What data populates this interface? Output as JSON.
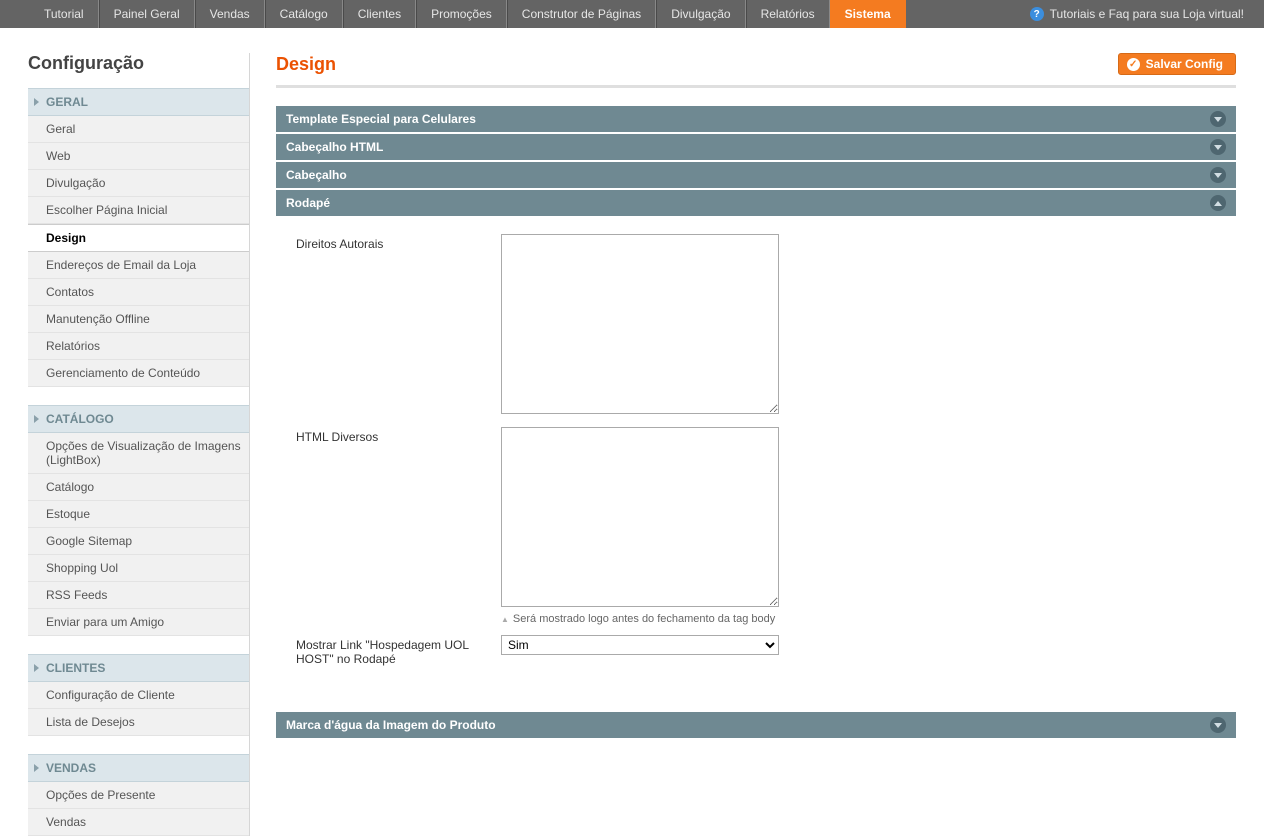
{
  "topnav": {
    "items": [
      {
        "label": "Tutorial"
      },
      {
        "label": "Painel Geral"
      },
      {
        "label": "Vendas"
      },
      {
        "label": "Catálogo"
      },
      {
        "label": "Clientes"
      },
      {
        "label": "Promoções"
      },
      {
        "label": "Construtor de Páginas"
      },
      {
        "label": "Divulgação"
      },
      {
        "label": "Relatórios"
      },
      {
        "label": "Sistema",
        "active": true
      }
    ],
    "help": "Tutoriais e Faq para sua Loja virtual!"
  },
  "sidebar": {
    "title": "Configuração",
    "sections": [
      {
        "header": "GERAL",
        "items": [
          {
            "label": "Geral"
          },
          {
            "label": "Web"
          },
          {
            "label": "Divulgação"
          },
          {
            "label": "Escolher Página Inicial"
          },
          {
            "label": "Design",
            "active": true
          },
          {
            "label": "Endereços de Email da Loja"
          },
          {
            "label": "Contatos"
          },
          {
            "label": "Manutenção Offline"
          },
          {
            "label": "Relatórios"
          },
          {
            "label": "Gerenciamento de Conteúdo"
          }
        ]
      },
      {
        "header": "CATÁLOGO",
        "items": [
          {
            "label": "Opções de Visualização de Imagens (LightBox)"
          },
          {
            "label": "Catálogo"
          },
          {
            "label": "Estoque"
          },
          {
            "label": "Google Sitemap"
          },
          {
            "label": "Shopping Uol"
          },
          {
            "label": "RSS Feeds"
          },
          {
            "label": "Enviar para um Amigo"
          }
        ]
      },
      {
        "header": "CLIENTES",
        "items": [
          {
            "label": "Configuração de Cliente"
          },
          {
            "label": "Lista de Desejos"
          }
        ]
      },
      {
        "header": "VENDAS",
        "items": [
          {
            "label": "Opções de Presente"
          },
          {
            "label": "Vendas"
          }
        ]
      }
    ]
  },
  "content": {
    "title": "Design",
    "save_label": "Salvar Config",
    "sections": [
      {
        "title": "Template Especial para Celulares",
        "open": false
      },
      {
        "title": "Cabeçalho HTML",
        "open": false
      },
      {
        "title": "Cabeçalho",
        "open": false
      },
      {
        "title": "Rodapé",
        "open": true
      },
      {
        "title": "Marca d'água da Imagem do Produto",
        "open": false
      }
    ],
    "rodape": {
      "field1_label": "Direitos Autorais",
      "field1_value": "",
      "field2_label": "HTML Diversos",
      "field2_value": "",
      "field2_note": "Será mostrado logo antes do fechamento da tag body",
      "field3_label": "Mostrar Link \"Hospedagem UOL HOST\" no Rodapé",
      "field3_value": "Sim"
    }
  }
}
